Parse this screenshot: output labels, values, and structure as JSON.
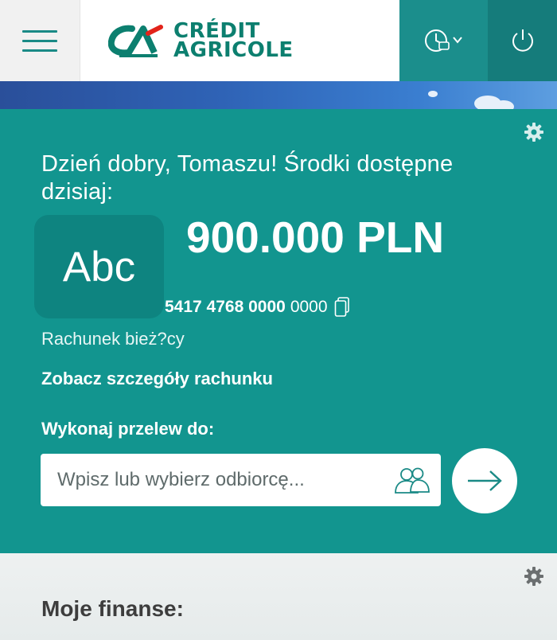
{
  "header": {
    "logo_line1": "CRÉDIT",
    "logo_line2": "AGRICOLE"
  },
  "main": {
    "greeting": "Dzień dobry, Tomaszu! Środki dostępne dzisiaj:",
    "avatar_text": "Abc",
    "balance": "900.000 PLN",
    "account_number_bold": "5417 4768 0000",
    "account_number_rest": "0000",
    "account_type": "Rachunek bież?cy",
    "details_link": "Zobacz szczegóły rachunku",
    "transfer_label": "Wykonaj przelew do:",
    "recipient_placeholder": "Wpisz lub wybierz odbiorcę..."
  },
  "finances": {
    "title": "Moje finanse:"
  },
  "icons": [
    "menu-icon",
    "logo-mark-icon",
    "clock-widget-icon",
    "power-icon",
    "gear-icon",
    "copy-icon",
    "contacts-icon",
    "arrow-right-icon"
  ],
  "colors": {
    "teal": "#12958f",
    "teal_dark": "#157c7b",
    "logo_green": "#0c7f6f",
    "logo_red": "#e2231a"
  }
}
